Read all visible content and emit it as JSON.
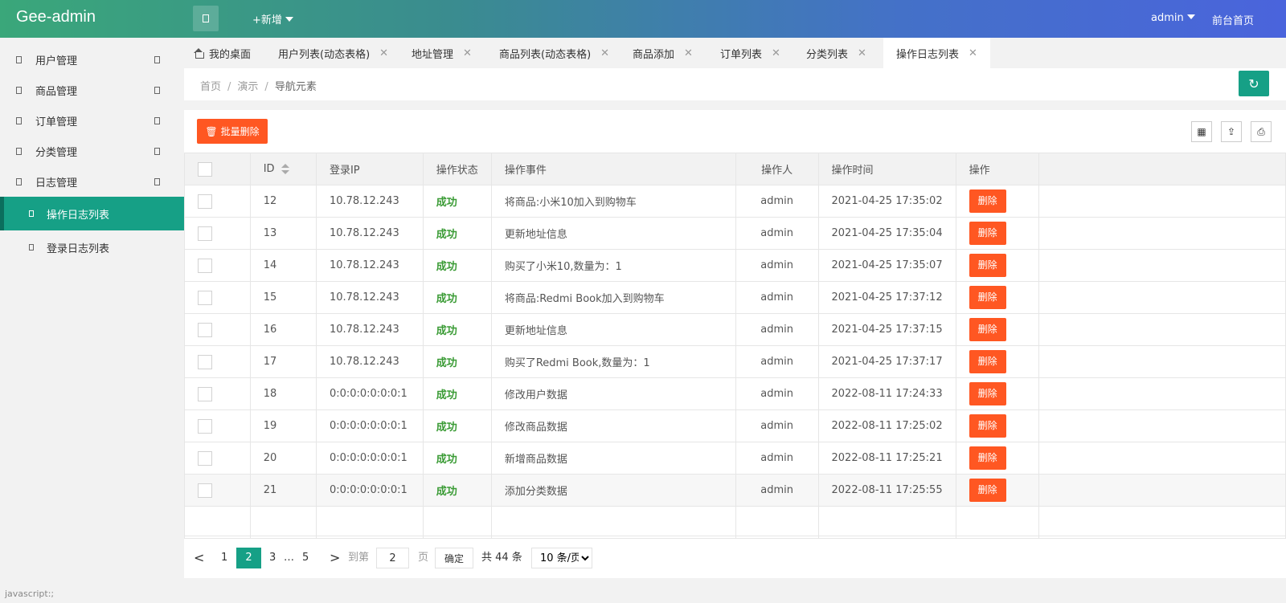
{
  "app": {
    "title": "Gee-admin",
    "new_label": "+新增",
    "user": "admin",
    "home_link": "前台首页"
  },
  "sidebar": {
    "menus": [
      "用户管理",
      "商品管理",
      "订单管理",
      "分类管理",
      "日志管理"
    ],
    "sub": [
      "操作日志列表",
      "登录日志列表"
    ],
    "active": "操作日志列表",
    "status": "javascript:;"
  },
  "tabs": [
    {
      "label": "我的桌面"
    },
    {
      "label": "用户列表(动态表格)"
    },
    {
      "label": "地址管理"
    },
    {
      "label": "商品列表(动态表格)"
    },
    {
      "label": "商品添加"
    },
    {
      "label": "订单列表"
    },
    {
      "label": "分类列表"
    },
    {
      "label": "操作日志列表"
    }
  ],
  "breadcrumb": [
    "首页",
    "演示",
    "导航元素"
  ],
  "toolbar": {
    "batch_delete": "批量删除"
  },
  "table": {
    "headers": [
      "ID",
      "登录IP",
      "操作状态",
      "操作事件",
      "操作人",
      "操作时间",
      "操作"
    ],
    "rows": [
      {
        "id": "12",
        "ip": "10.78.12.243",
        "status": "成功",
        "event": "将商品:小米10加入到购物车",
        "user": "admin",
        "time": "2021-04-25 17:35:02",
        "action": "删除"
      },
      {
        "id": "13",
        "ip": "10.78.12.243",
        "status": "成功",
        "event": "更新地址信息",
        "user": "admin",
        "time": "2021-04-25 17:35:04",
        "action": "删除"
      },
      {
        "id": "14",
        "ip": "10.78.12.243",
        "status": "成功",
        "event": "购买了小米10,数量为：1",
        "user": "admin",
        "time": "2021-04-25 17:35:07",
        "action": "删除"
      },
      {
        "id": "15",
        "ip": "10.78.12.243",
        "status": "成功",
        "event": "将商品:Redmi Book加入到购物车",
        "user": "admin",
        "time": "2021-04-25 17:37:12",
        "action": "删除"
      },
      {
        "id": "16",
        "ip": "10.78.12.243",
        "status": "成功",
        "event": "更新地址信息",
        "user": "admin",
        "time": "2021-04-25 17:37:15",
        "action": "删除"
      },
      {
        "id": "17",
        "ip": "10.78.12.243",
        "status": "成功",
        "event": "购买了Redmi Book,数量为：1",
        "user": "admin",
        "time": "2021-04-25 17:37:17",
        "action": "删除"
      },
      {
        "id": "18",
        "ip": "0:0:0:0:0:0:0:1",
        "status": "成功",
        "event": "修改用户数据",
        "user": "admin",
        "time": "2022-08-11 17:24:33",
        "action": "删除"
      },
      {
        "id": "19",
        "ip": "0:0:0:0:0:0:0:1",
        "status": "成功",
        "event": "修改商品数据",
        "user": "admin",
        "time": "2022-08-11 17:25:02",
        "action": "删除"
      },
      {
        "id": "20",
        "ip": "0:0:0:0:0:0:0:1",
        "status": "成功",
        "event": "新增商品数据",
        "user": "admin",
        "time": "2022-08-11 17:25:21",
        "action": "删除"
      },
      {
        "id": "21",
        "ip": "0:0:0:0:0:0:0:1",
        "status": "成功",
        "event": "添加分类数据",
        "user": "admin",
        "time": "2022-08-11 17:25:55",
        "action": "删除"
      }
    ]
  },
  "pagination": {
    "prev": "<",
    "pages": [
      "1",
      "2",
      "3",
      "…",
      "5"
    ],
    "current": "2",
    "next": ">",
    "goto_label": "到第",
    "goto_value": "2",
    "page_unit": "页",
    "confirm": "确定",
    "total": "共 44 条",
    "page_size": "10 条/页"
  },
  "colors": {
    "accent": "#16a086",
    "danger": "#ff5722"
  }
}
